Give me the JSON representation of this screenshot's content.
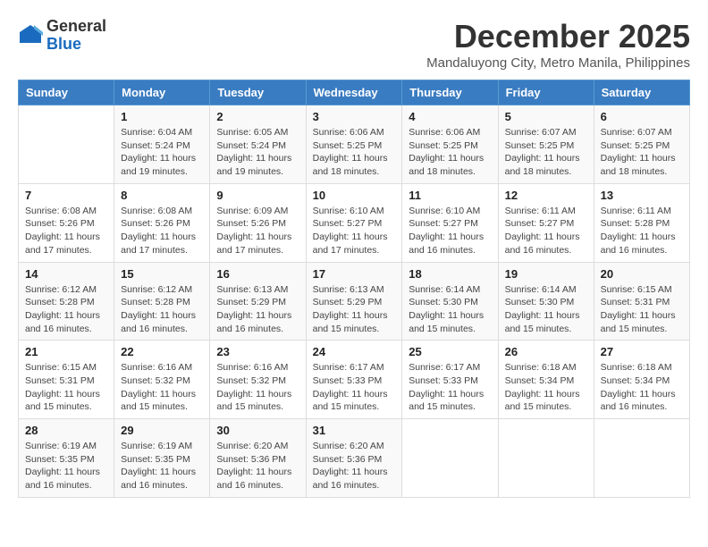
{
  "header": {
    "logo_line1": "General",
    "logo_line2": "Blue",
    "month": "December 2025",
    "location": "Mandaluyong City, Metro Manila, Philippines"
  },
  "weekdays": [
    "Sunday",
    "Monday",
    "Tuesday",
    "Wednesday",
    "Thursday",
    "Friday",
    "Saturday"
  ],
  "weeks": [
    [
      {
        "day": "",
        "info": ""
      },
      {
        "day": "1",
        "info": "Sunrise: 6:04 AM\nSunset: 5:24 PM\nDaylight: 11 hours\nand 19 minutes."
      },
      {
        "day": "2",
        "info": "Sunrise: 6:05 AM\nSunset: 5:24 PM\nDaylight: 11 hours\nand 19 minutes."
      },
      {
        "day": "3",
        "info": "Sunrise: 6:06 AM\nSunset: 5:25 PM\nDaylight: 11 hours\nand 18 minutes."
      },
      {
        "day": "4",
        "info": "Sunrise: 6:06 AM\nSunset: 5:25 PM\nDaylight: 11 hours\nand 18 minutes."
      },
      {
        "day": "5",
        "info": "Sunrise: 6:07 AM\nSunset: 5:25 PM\nDaylight: 11 hours\nand 18 minutes."
      },
      {
        "day": "6",
        "info": "Sunrise: 6:07 AM\nSunset: 5:25 PM\nDaylight: 11 hours\nand 18 minutes."
      }
    ],
    [
      {
        "day": "7",
        "info": "Sunrise: 6:08 AM\nSunset: 5:26 PM\nDaylight: 11 hours\nand 17 minutes."
      },
      {
        "day": "8",
        "info": "Sunrise: 6:08 AM\nSunset: 5:26 PM\nDaylight: 11 hours\nand 17 minutes."
      },
      {
        "day": "9",
        "info": "Sunrise: 6:09 AM\nSunset: 5:26 PM\nDaylight: 11 hours\nand 17 minutes."
      },
      {
        "day": "10",
        "info": "Sunrise: 6:10 AM\nSunset: 5:27 PM\nDaylight: 11 hours\nand 17 minutes."
      },
      {
        "day": "11",
        "info": "Sunrise: 6:10 AM\nSunset: 5:27 PM\nDaylight: 11 hours\nand 16 minutes."
      },
      {
        "day": "12",
        "info": "Sunrise: 6:11 AM\nSunset: 5:27 PM\nDaylight: 11 hours\nand 16 minutes."
      },
      {
        "day": "13",
        "info": "Sunrise: 6:11 AM\nSunset: 5:28 PM\nDaylight: 11 hours\nand 16 minutes."
      }
    ],
    [
      {
        "day": "14",
        "info": "Sunrise: 6:12 AM\nSunset: 5:28 PM\nDaylight: 11 hours\nand 16 minutes."
      },
      {
        "day": "15",
        "info": "Sunrise: 6:12 AM\nSunset: 5:28 PM\nDaylight: 11 hours\nand 16 minutes."
      },
      {
        "day": "16",
        "info": "Sunrise: 6:13 AM\nSunset: 5:29 PM\nDaylight: 11 hours\nand 16 minutes."
      },
      {
        "day": "17",
        "info": "Sunrise: 6:13 AM\nSunset: 5:29 PM\nDaylight: 11 hours\nand 15 minutes."
      },
      {
        "day": "18",
        "info": "Sunrise: 6:14 AM\nSunset: 5:30 PM\nDaylight: 11 hours\nand 15 minutes."
      },
      {
        "day": "19",
        "info": "Sunrise: 6:14 AM\nSunset: 5:30 PM\nDaylight: 11 hours\nand 15 minutes."
      },
      {
        "day": "20",
        "info": "Sunrise: 6:15 AM\nSunset: 5:31 PM\nDaylight: 11 hours\nand 15 minutes."
      }
    ],
    [
      {
        "day": "21",
        "info": "Sunrise: 6:15 AM\nSunset: 5:31 PM\nDaylight: 11 hours\nand 15 minutes."
      },
      {
        "day": "22",
        "info": "Sunrise: 6:16 AM\nSunset: 5:32 PM\nDaylight: 11 hours\nand 15 minutes."
      },
      {
        "day": "23",
        "info": "Sunrise: 6:16 AM\nSunset: 5:32 PM\nDaylight: 11 hours\nand 15 minutes."
      },
      {
        "day": "24",
        "info": "Sunrise: 6:17 AM\nSunset: 5:33 PM\nDaylight: 11 hours\nand 15 minutes."
      },
      {
        "day": "25",
        "info": "Sunrise: 6:17 AM\nSunset: 5:33 PM\nDaylight: 11 hours\nand 15 minutes."
      },
      {
        "day": "26",
        "info": "Sunrise: 6:18 AM\nSunset: 5:34 PM\nDaylight: 11 hours\nand 15 minutes."
      },
      {
        "day": "27",
        "info": "Sunrise: 6:18 AM\nSunset: 5:34 PM\nDaylight: 11 hours\nand 16 minutes."
      }
    ],
    [
      {
        "day": "28",
        "info": "Sunrise: 6:19 AM\nSunset: 5:35 PM\nDaylight: 11 hours\nand 16 minutes."
      },
      {
        "day": "29",
        "info": "Sunrise: 6:19 AM\nSunset: 5:35 PM\nDaylight: 11 hours\nand 16 minutes."
      },
      {
        "day": "30",
        "info": "Sunrise: 6:20 AM\nSunset: 5:36 PM\nDaylight: 11 hours\nand 16 minutes."
      },
      {
        "day": "31",
        "info": "Sunrise: 6:20 AM\nSunset: 5:36 PM\nDaylight: 11 hours\nand 16 minutes."
      },
      {
        "day": "",
        "info": ""
      },
      {
        "day": "",
        "info": ""
      },
      {
        "day": "",
        "info": ""
      }
    ]
  ]
}
